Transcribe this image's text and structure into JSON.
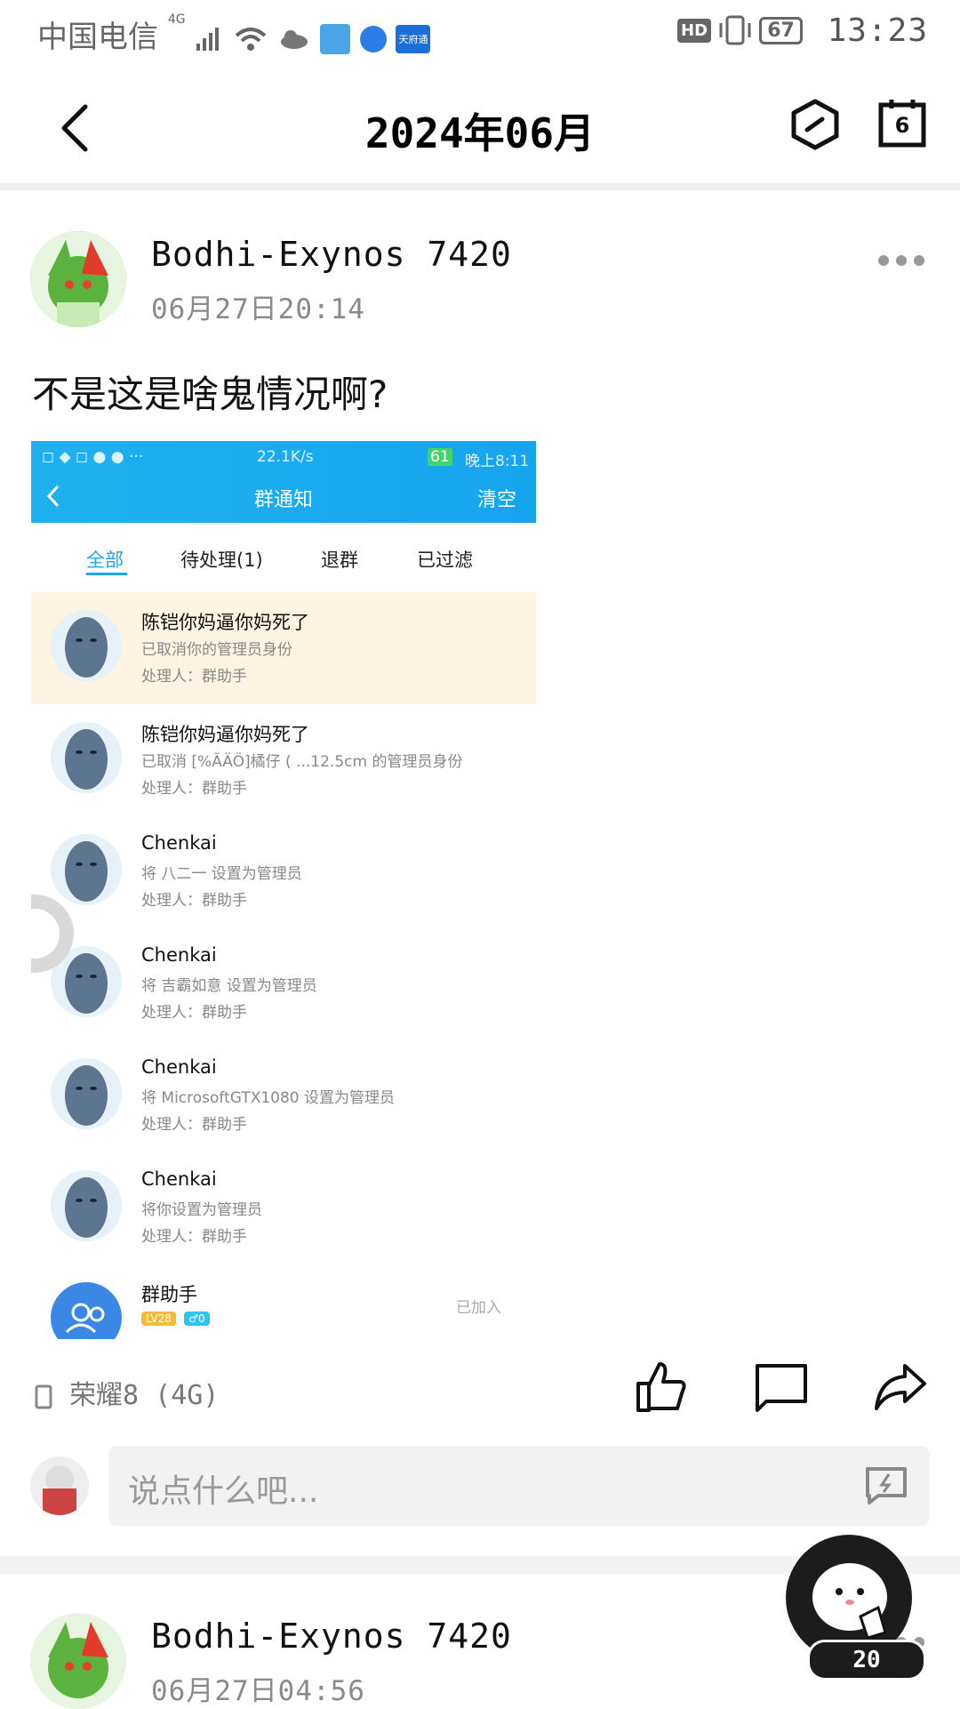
{
  "status_bar": {
    "carrier": "中国电信",
    "network": "4G",
    "app_badge": "天府通",
    "hd": "HD",
    "battery": "67",
    "time": "13:23"
  },
  "nav": {
    "title": "2024年06月",
    "icons": [
      "back-arrow-icon",
      "hexagon-icon",
      "calendar-icon"
    ],
    "calendar_day": "6"
  },
  "post": {
    "username": "Bodhi-Exynos 7420",
    "date": "06月27日20:14",
    "text": "不是这是啥鬼情况啊?",
    "device": "荣耀8 (4G)",
    "screenshot": {
      "status": {
        "speed": "22.1K/s",
        "battery": "61",
        "time": "晚上8:11"
      },
      "title": "群通知",
      "clear": "清空",
      "tabs": [
        "全部",
        "待处理(1)",
        "退群",
        "已过滤"
      ],
      "notices": [
        {
          "name": "陈铠你妈逼你妈死了",
          "desc": "已取消你的管理员身份",
          "proc": "处理人：群助手"
        },
        {
          "name": "陈铠你妈逼你妈死了",
          "desc": "已取消 [%ÃÄÖ]橘仔 ( ...12.5cm 的管理员身份",
          "proc": "处理人：群助手"
        },
        {
          "name": "Chenkai",
          "desc": "将 八二一 设置为管理员",
          "proc": "处理人：群助手"
        },
        {
          "name": "Chenkai",
          "desc": "将 吉霸如意 设置为管理员",
          "proc": "处理人：群助手"
        },
        {
          "name": "Chenkai",
          "desc": "将 MicrosoftGTX1080 设置为管理员",
          "proc": "处理人：群助手"
        },
        {
          "name": "Chenkai",
          "desc": "将你设置为管理员",
          "proc": "处理人：群助手"
        }
      ],
      "last_notice": {
        "name": "群助手",
        "level": "LV28",
        "gender": "♂0",
        "status": "已加入"
      }
    }
  },
  "comment": {
    "placeholder": "说点什么吧..."
  },
  "next_post": {
    "username": "Bodhi-Exynos 7420",
    "date": "06月27日04:56"
  },
  "float": {
    "count": "20"
  },
  "colors": {
    "accent": "#1aa7ee",
    "highlight_row": "#fdf4e3"
  }
}
